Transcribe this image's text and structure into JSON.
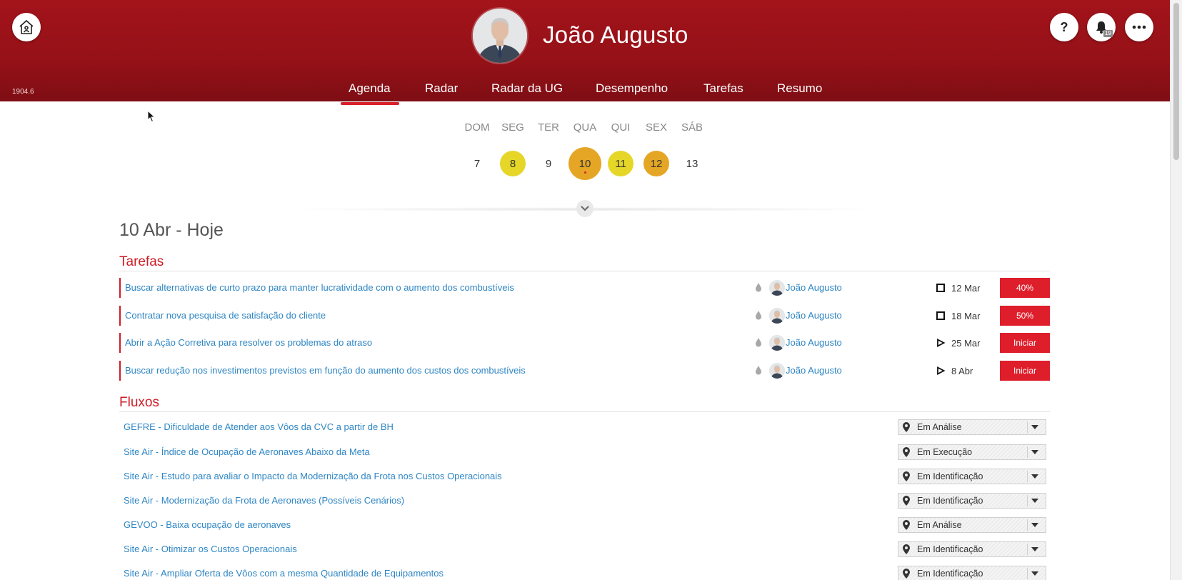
{
  "header": {
    "user_name": "João Augusto",
    "version": "1904.6",
    "notifications_count": "19",
    "help_label": "?",
    "nav": [
      {
        "label": "Agenda",
        "active": true
      },
      {
        "label": "Radar"
      },
      {
        "label": "Radar da UG"
      },
      {
        "label": "Desempenho"
      },
      {
        "label": "Tarefas"
      },
      {
        "label": "Resumo"
      }
    ]
  },
  "calendar": {
    "day_names": [
      "DOM",
      "SEG",
      "TER",
      "QUA",
      "QUI",
      "SEX",
      "SÁB"
    ],
    "days": [
      {
        "num": "7",
        "color": null
      },
      {
        "num": "8",
        "color": "#e5d628"
      },
      {
        "num": "9",
        "color": null
      },
      {
        "num": "10",
        "color": "#e5a625",
        "today": true
      },
      {
        "num": "11",
        "color": "#e5d628"
      },
      {
        "num": "12",
        "color": "#e5a625"
      },
      {
        "num": "13",
        "color": null
      }
    ]
  },
  "date_heading": "10 Abr - Hoje",
  "tasks": {
    "title": "Tarefas",
    "items": [
      {
        "text": "Buscar alternativas de curto prazo para manter lucratividade com o aumento dos combustíveis",
        "assignee": "João Augusto",
        "status_icon": "square-icon",
        "date": "12 Mar",
        "action": "40%"
      },
      {
        "text": "Contratar nova pesquisa de satisfação do cliente",
        "assignee": "João Augusto",
        "status_icon": "square-icon",
        "date": "18 Mar",
        "action": "50%"
      },
      {
        "text": "Abrir a Ação Corretiva para resolver os problemas do atraso",
        "assignee": "João Augusto",
        "status_icon": "play-icon",
        "date": "25 Mar",
        "action": "Iniciar"
      },
      {
        "text": "Buscar redução nos investimentos previstos em função do aumento dos custos dos combustíveis",
        "assignee": "João Augusto",
        "status_icon": "play-icon",
        "date": "8 Abr",
        "action": "Iniciar"
      }
    ]
  },
  "flows": {
    "title": "Fluxos",
    "items": [
      {
        "text": "GEFRE - Dificuldade de Atender aos Vôos da CVC a partir de BH",
        "status": "Em Análise"
      },
      {
        "text": "Site Air - Índice de Ocupação de Aeronaves Abaixo da Meta",
        "status": "Em Execução"
      },
      {
        "text": "Site Air - Estudo para avaliar o Impacto da Modernização da Frota nos Custos Operacionais",
        "status": "Em Identificação"
      },
      {
        "text": "Site Air - Modernização da Frota de Aeronaves (Possíveis Cenários)",
        "status": "Em Identificação"
      },
      {
        "text": "GEVOO - Baixa ocupação de aeronaves",
        "status": "Em Análise"
      },
      {
        "text": "Site Air - Otimizar os Custos Operacionais",
        "status": "Em Identificação"
      },
      {
        "text": "Site Air - Ampliar Oferta de Vôos com a mesma Quantidade de Equipamentos",
        "status": "Em Identificação"
      }
    ]
  },
  "colors": {
    "brand": "#9a1219",
    "accent": "#de1e2b",
    "link": "#2f86c4"
  }
}
